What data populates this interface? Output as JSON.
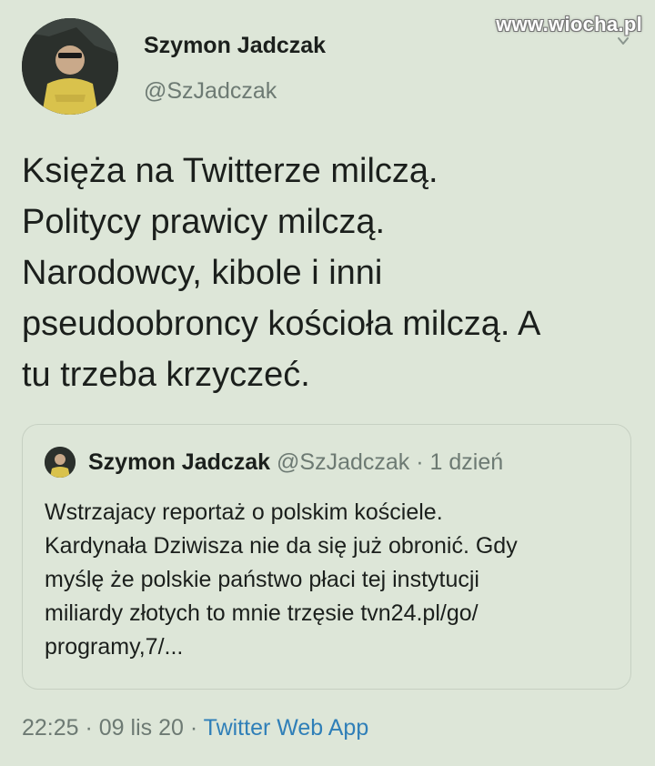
{
  "watermark": "www.wiocha.pl",
  "author": {
    "name": "Szymon Jadczak",
    "handle": "@SzJadczak"
  },
  "tweet": {
    "lines": [
      "Księża na Twitterze milczą.",
      "Politycy prawicy milczą.",
      "Narodowcy, kibole i inni",
      "pseudoobroncy kościoła milczą. A",
      "tu trzeba krzyczeć."
    ]
  },
  "quoted": {
    "name": "Szymon Jadczak",
    "handle": "@SzJadczak",
    "separator": " · ",
    "time": "1 dzień",
    "lines": [
      "Wstrzajacy reportaż o polskim kościele.",
      "Kardynała Dziwisza nie da się już obronić. Gdy",
      "myślę że polskie państwo płaci tej instytucji",
      "miliardy złotych to mnie trzęsie tvn24.pl/go/",
      "programy,7/..."
    ]
  },
  "footer": {
    "time": "22:25",
    "date": "09 lis 20",
    "separator": " · ",
    "app": "Twitter Web App"
  },
  "colors": {
    "background": "#dde6d8",
    "text": "#1b1f1c",
    "muted": "#6d7a73",
    "link": "#2f7fb8"
  }
}
